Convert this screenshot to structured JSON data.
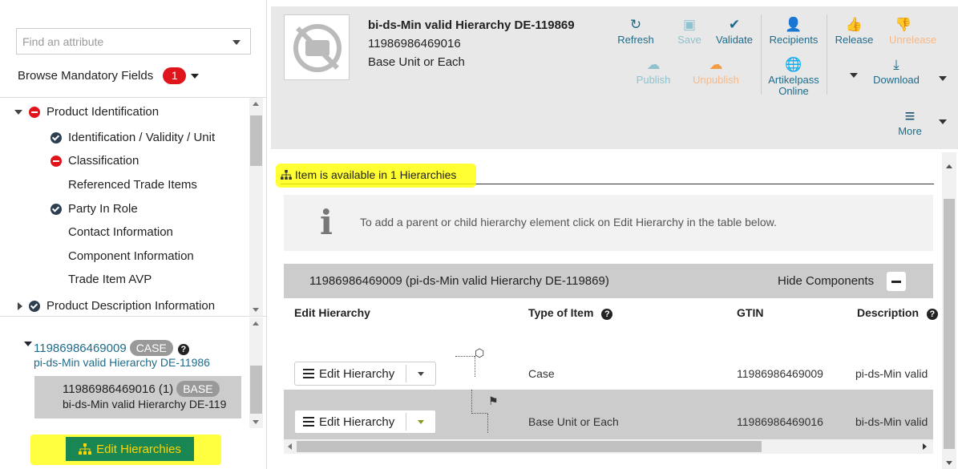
{
  "left": {
    "search_placeholder": "Find an attribute",
    "browse_label": "Browse Mandatory Fields",
    "browse_count": "1",
    "tree": {
      "product_identification": "Product Identification",
      "identification_validity_unit": "Identification / Validity / Unit",
      "classification": "Classification",
      "referenced_trade_items": "Referenced Trade Items",
      "party_in_role": "Party In Role",
      "contact_information": "Contact Information",
      "component_information": "Component Information",
      "trade_item_avp": "Trade Item AVP",
      "product_description_information": "Product Description Information"
    },
    "hierarchy": {
      "parent_gtin": "11986986469009",
      "parent_type": "CASE",
      "parent_desc": "pi-ds-Min valid Hierarchy DE-11986",
      "child_line1": "11986986469016 (1)",
      "child_type": "BASE",
      "child_desc": "bi-ds-Min valid Hierarchy DE-119"
    },
    "edit_hierarchies_label": "Edit Hierarchies"
  },
  "header": {
    "title": "bi-ds-Min valid Hierarchy DE-119869",
    "gtin": "11986986469016",
    "unit": "Base Unit or Each",
    "toolbar": {
      "refresh": "Refresh",
      "save": "Save",
      "validate": "Validate",
      "recipients": "Recipients",
      "release": "Release",
      "unrelease": "Unrelease",
      "publish": "Publish",
      "unpublish": "Unpublish",
      "artikelpass": "Artikelpass Online",
      "download": "Download",
      "more": "More"
    }
  },
  "main": {
    "availability": "Item is available in 1 Hierarchies",
    "info_message": "To add a parent or child hierarchy element click on Edit Hierarchy in the table below.",
    "grid_title": "11986986469009 (pi-ds-Min valid Hierarchy DE-119869)",
    "hide_components": "Hide Components",
    "columns": {
      "edit_hierarchy": "Edit Hierarchy",
      "type_of_item": "Type of Item",
      "gtin": "GTIN",
      "description": "Description"
    },
    "rows": [
      {
        "button": "Edit Hierarchy",
        "type": "Case",
        "gtin": "11986986469009",
        "desc": "pi-ds-Min valid"
      },
      {
        "button": "Edit Hierarchy",
        "type": "Base Unit or Each",
        "gtin": "11986986469016",
        "desc": "bi-ds-Min valid"
      }
    ]
  },
  "colors": {
    "accent_teal": "#1d6b8a",
    "badge_red": "#e0151b",
    "button_green": "#198754",
    "highlight_yellow": "#ffff00"
  }
}
